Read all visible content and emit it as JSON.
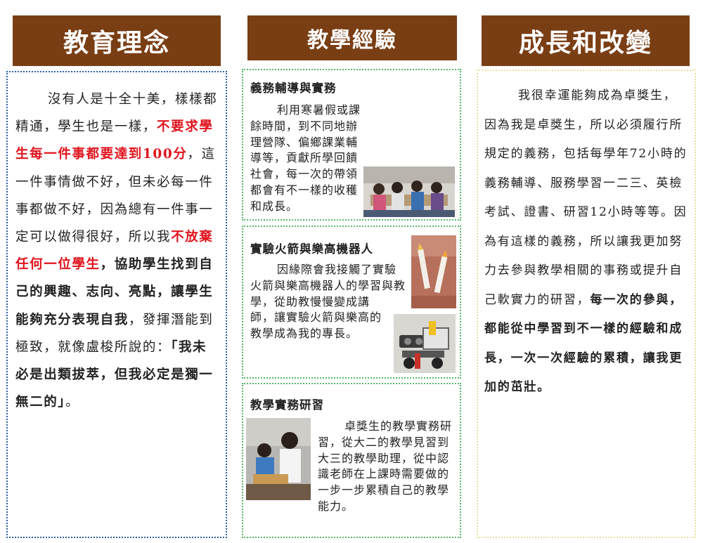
{
  "column1": {
    "header": "教育理念",
    "paragraph": {
      "p1": "沒有人是十全十美，樣樣都精通，學生也是一樣，",
      "p2_red": "不要求學生每一件事都要達到100分",
      "p3": "，這一件事情做不好，但未必每一件事都做不好，因為總有一件事一定可以做得很好，所以我",
      "p4_red": "不放棄任何一位學生",
      "p5_bold": "，協助學生找到自己的興趣、志向、亮點，讓學生能夠充分表現自我",
      "p6": "，發揮潛能到極致，就像盧梭所說的：",
      "p7_bold": "「我未必是出類拔萃，但我必定是獨一無二的」",
      "p8": "。"
    }
  },
  "column2": {
    "header": "教學經驗",
    "sections": [
      {
        "title": "義務輔導與實務",
        "body": "利用寒暑假或課餘時間，到不同地辦理營隊、偏鄉課業輔導等，貢獻所學回饋社會，每一次的帶領都會有不一樣的收穫和成長。"
      },
      {
        "title": "實驗火箭與樂高機器人",
        "body": "因緣際會我接觸了實驗火箭與樂高機器人的學習與教學，從助教慢慢變成講師，讓實驗火箭與樂高的教學成為我的專長。"
      },
      {
        "title": "教學實務研習",
        "body": "卓獎生的教學實務研習，從大二的教學見習到大三的教學助理，從中認識老師在上課時需要做的一步一步累積自己的教學能力。"
      }
    ]
  },
  "column3": {
    "header": "成長和改變",
    "paragraph": {
      "p1": "我很幸運能夠成為卓獎生，因為我是卓獎生，所以必須履行所規定的義務，包括每學年72小時的義務輔導、服務學習一二三、英檢考試、證書、研習12小時等等。因為有這樣的義務，所以讓我更加努力去參與教學相關的事務或提升自己軟實力的研習，",
      "p2_bold": "每一次的參與，都能從中學習到不一樣的經驗和成長，一次一次經驗的累積，讓我更加的茁壯。"
    }
  },
  "colors": {
    "header_bg": "#7a3e14",
    "header_text": "#ffffff",
    "emphasis_red": "#e0141e",
    "border_blue": "#2b5fa8",
    "border_green": "#58b86a",
    "border_yellow": "#e8e0a0"
  }
}
